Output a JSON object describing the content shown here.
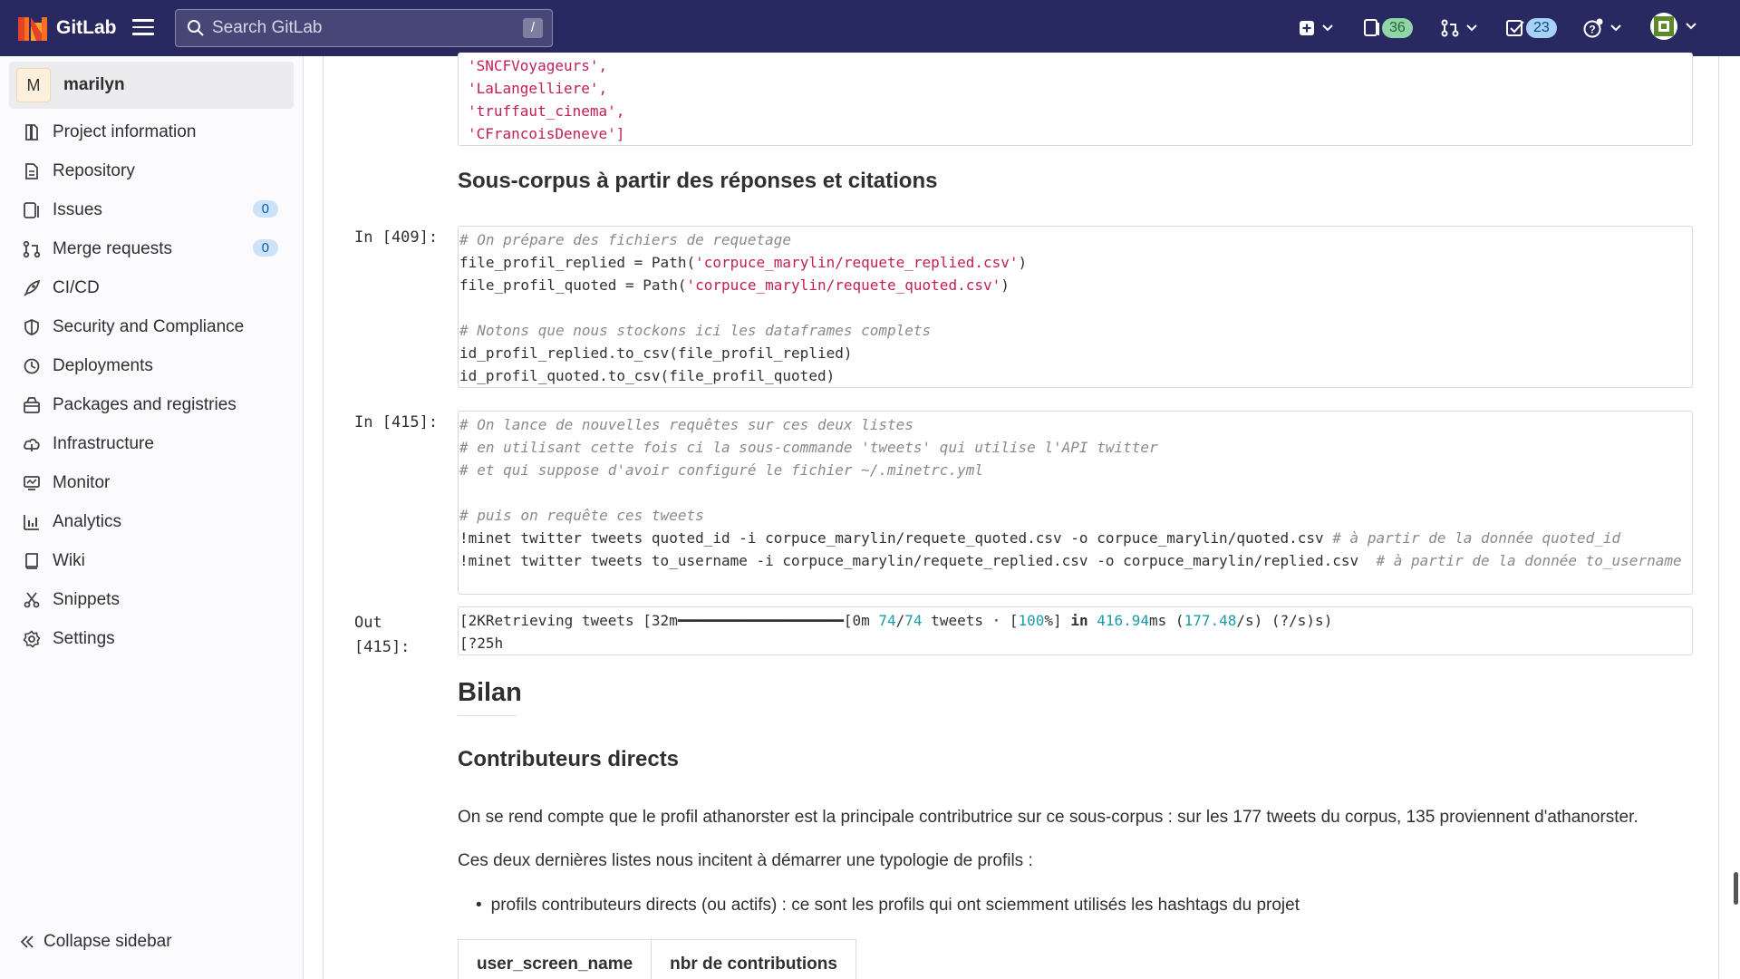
{
  "topbar": {
    "brand": "GitLab",
    "search_placeholder": "Search GitLab",
    "search_shortcut": "/",
    "issues_count": "36",
    "todos_count": "23",
    "icons": [
      "tanuki-logo",
      "hamburger-icon",
      "search-icon",
      "plus-square-icon",
      "issues-icon",
      "merge-request-icon",
      "todo-icon",
      "help-icon",
      "user-avatar"
    ]
  },
  "sidebar": {
    "project_initial": "M",
    "project_name": "marilyn",
    "items": [
      {
        "label": "Project information",
        "icon": "project-icon"
      },
      {
        "label": "Repository",
        "icon": "doc-icon"
      },
      {
        "label": "Issues",
        "icon": "issues-icon",
        "badge": "0"
      },
      {
        "label": "Merge requests",
        "icon": "merge-request-icon",
        "badge": "0"
      },
      {
        "label": "CI/CD",
        "icon": "rocket-icon"
      },
      {
        "label": "Security and Compliance",
        "icon": "shield-icon"
      },
      {
        "label": "Deployments",
        "icon": "deployments-icon"
      },
      {
        "label": "Packages and registries",
        "icon": "package-icon"
      },
      {
        "label": "Infrastructure",
        "icon": "cloud-icon"
      },
      {
        "label": "Monitor",
        "icon": "monitor-icon"
      },
      {
        "label": "Analytics",
        "icon": "chart-icon"
      },
      {
        "label": "Wiki",
        "icon": "book-icon"
      },
      {
        "label": "Snippets",
        "icon": "scissors-icon"
      },
      {
        "label": "Settings",
        "icon": "gear-icon"
      }
    ],
    "collapse_label": "Collapse sidebar"
  },
  "notebook": {
    "top_cell_lines": [
      "'SNCFVoyageurs',",
      "'LaLangelliere',",
      "'truffaut_cinema',",
      "'CFrancoisDeneve']"
    ],
    "heading_subcorpus": "Sous-corpus à partir des réponses et citations",
    "cell_409": {
      "prompt": "In [409]:",
      "comment1": "# On prépare des fichiers de requetage",
      "l2a": "file_profil_replied = Path(",
      "l2s": "'corpuce_marylin/requete_replied.csv'",
      "l2b": ")",
      "l3a": "file_profil_quoted = Path(",
      "l3s": "'corpuce_marylin/requete_quoted.csv'",
      "l3b": ")",
      "comment2": "# Notons que nous stockons ici les dataframes complets",
      "l6": "id_profil_replied.to_csv(file_profil_replied)",
      "l7": "id_profil_quoted.to_csv(file_profil_quoted)"
    },
    "cell_415": {
      "prompt": "In [415]:",
      "c1": "# On lance de nouvelles requêtes sur ces deux listes",
      "c2": "# en utilisant cette fois ci la sous-commande 'tweets' qui utilise l'API twitter",
      "c3": "# et qui suppose d'avoir configuré le fichier ~/.minetrc.yml",
      "c4": "# puis on requête ces tweets",
      "cmd1": "!minet twitter tweets quoted_id -i corpuce_marylin/requete_quoted.csv -o corpuce_marylin/quoted.csv ",
      "cmd1c": "# à partir de la donnée quoted_id",
      "cmd2": "!minet twitter tweets to_username -i corpuce_marylin/requete_replied.csv -o corpuce_marylin/replied.csv  ",
      "cmd2c": "# à partir de la donnée to_username"
    },
    "out_415": {
      "prompt1": "Out",
      "prompt2": "[415]:",
      "p1": "[2KRetrieving tweets [32m━━━━━━━━━━━━━━━━━━━[0m ",
      "n1": "74",
      "slash": "/",
      "n2": "74",
      "p2": " tweets · [",
      "n3": "100",
      "p3": "%] ",
      "kw_in": "in",
      "p4": " ",
      "n4": "416.94",
      "p5": "ms (",
      "n5": "177.48",
      "p6": "/s) (?/s)s)",
      "line2": "[?25h"
    },
    "heading_bilan": "Bilan",
    "heading_contrib": "Contributeurs directs",
    "para1": "On se rend compte que le profil athanorster est la principale contributrice sur ce sous-corpus : sur les 177 tweets du corpus, 135 proviennent d'athanorster.",
    "para2": "Ces deux dernières listes nous incitent à démarrer une typologie de profils :",
    "bullet1": "profils contributeurs directs (ou actifs) : ce sont les profils qui ont sciemment utilisés les hashtags du projet",
    "table_headers": [
      "user_screen_name",
      "nbr de contributions"
    ]
  }
}
